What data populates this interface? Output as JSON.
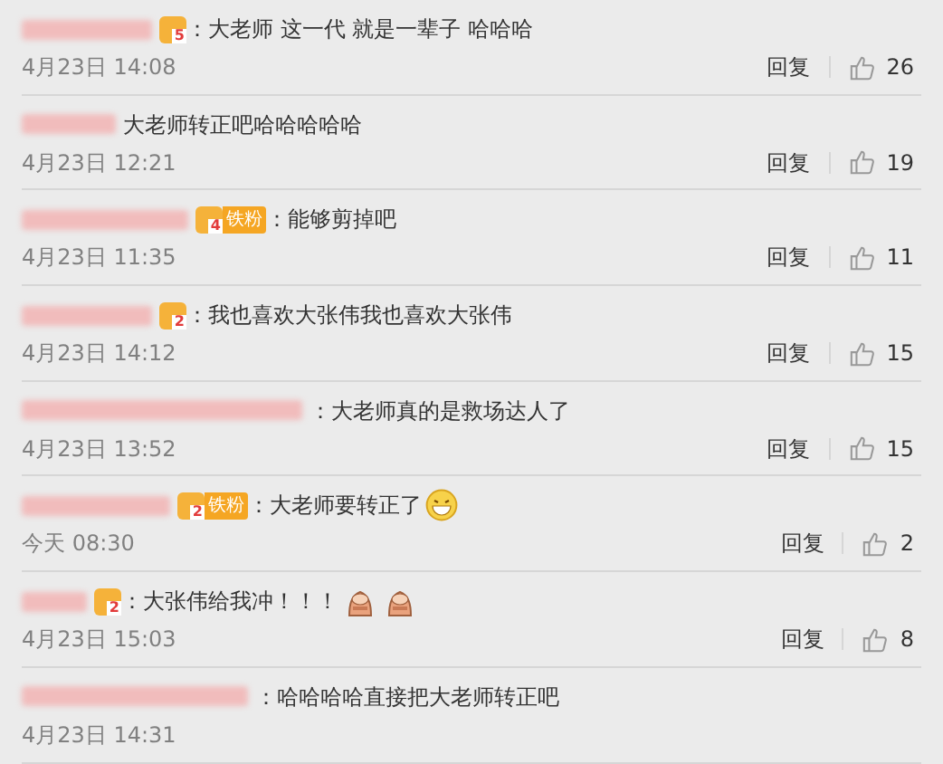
{
  "comments": [
    {
      "badge": {
        "level": "5"
      },
      "text": "：大老师 这一代 就是一辈子 哈哈哈",
      "time": "4月23日 14:08",
      "reply": "回复",
      "likes": "26"
    },
    {
      "text": "大老师转正吧哈哈哈哈哈",
      "time": "4月23日 12:21",
      "reply": "回复",
      "likes": "19"
    },
    {
      "badge": {
        "level": "4",
        "fan_label": "铁粉"
      },
      "text": "：能够剪掉吧",
      "time": "4月23日 11:35",
      "reply": "回复",
      "likes": "11"
    },
    {
      "badge": {
        "level": "2"
      },
      "text": "：我也喜欢大张伟我也喜欢大张伟",
      "time": "4月23日 14:12",
      "reply": "回复",
      "likes": "15"
    },
    {
      "text": "：大老师真的是救场达人了",
      "time": "4月23日 13:52",
      "reply": "回复",
      "likes": "15"
    },
    {
      "badge": {
        "level": "2",
        "fan_label": "铁粉"
      },
      "text": "：大老师要转正了",
      "emojis": [
        {
          "kind": "grin"
        }
      ],
      "time": "今天 08:30",
      "reply": "回复",
      "likes": "2"
    },
    {
      "badge": {
        "level": "2"
      },
      "text": "：大张伟给我冲！！！",
      "emojis": [
        {
          "kind": "figure"
        },
        {
          "kind": "figure"
        }
      ],
      "time": "4月23日 15:03",
      "reply": "回复",
      "likes": "8"
    },
    {
      "text": "：哈哈哈哈直接把大老师转正吧",
      "time": "4月23日 14:31"
    }
  ]
}
